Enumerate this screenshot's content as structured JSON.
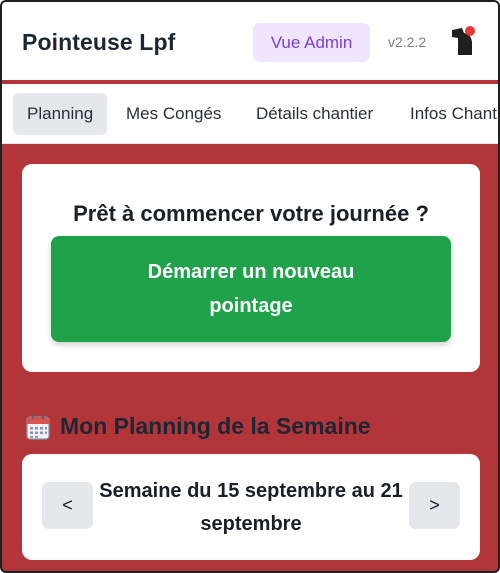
{
  "header": {
    "app_title": "Pointeuse Lpf",
    "admin_button": "Vue Admin",
    "version": "v2.2.2",
    "notification_icon": "bell-icon",
    "notification_dot_color": "#e53935"
  },
  "tabs": [
    {
      "label": "Planning",
      "active": true
    },
    {
      "label": "Mes Congés",
      "active": false
    },
    {
      "label": "Détails chantier",
      "active": false
    },
    {
      "label": "Infos Chant",
      "active": false
    }
  ],
  "start_card": {
    "title": "Prêt à commencer votre journée ?",
    "button_label": "Démarrer un nouveau pointage"
  },
  "planning": {
    "section_icon": "calendar-icon",
    "title": "Mon Planning de la Semaine",
    "prev_label": "<",
    "next_label": ">",
    "week_label": "Semaine du 15 septembre au 21 septembre"
  },
  "colors": {
    "brand_red": "#b13539",
    "start_green": "#1fa24a",
    "admin_purple": "#7b3fd6"
  }
}
